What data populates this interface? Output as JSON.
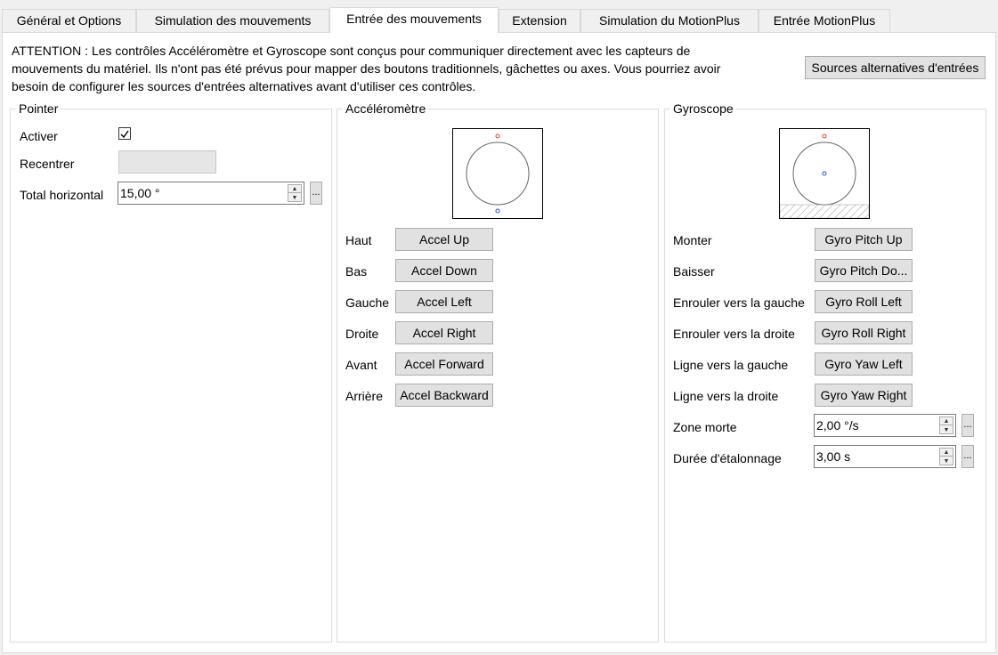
{
  "tabs": [
    {
      "label": "Général et Options"
    },
    {
      "label": "Simulation des mouvements"
    },
    {
      "label": "Entrée des mouvements"
    },
    {
      "label": "Extension"
    },
    {
      "label": "Simulation du MotionPlus"
    },
    {
      "label": "Entrée MotionPlus"
    }
  ],
  "active_tab": "Entrée des mouvements",
  "warning": {
    "line1": "ATTENTION : Les contrôles Accéléromètre et Gyroscope sont conçus pour communiquer directement avec les capteurs de",
    "line2": "mouvements du matériel. Ils n'ont pas été prévus pour mapper des boutons traditionnels, gâchettes ou axes. Vous pourriez avoir",
    "line3": "besoin de configurer les sources d'entrées alternatives avant d'utiliser ces contrôles."
  },
  "alt_sources_button": "Sources alternatives d'entrées",
  "pointer": {
    "title": "Pointer",
    "enable_label": "Activer",
    "enable_checked": true,
    "recenter_label": "Recentrer",
    "total_horizontal_label": "Total horizontal",
    "total_horizontal_value": "15,00 °",
    "more": "..."
  },
  "accelerometer": {
    "title": "Accéléromètre",
    "rows": [
      {
        "label": "Haut",
        "button": "Accel Up"
      },
      {
        "label": "Bas",
        "button": "Accel Down"
      },
      {
        "label": "Gauche",
        "button": "Accel Left"
      },
      {
        "label": "Droite",
        "button": "Accel Right"
      },
      {
        "label": "Avant",
        "button": "Accel Forward"
      },
      {
        "label": "Arrière",
        "button": "Accel Backward"
      }
    ]
  },
  "gyroscope": {
    "title": "Gyroscope",
    "rows": [
      {
        "label": "Monter",
        "button": "Gyro Pitch Up"
      },
      {
        "label": "Baisser",
        "button": "Gyro Pitch Do..."
      },
      {
        "label": "Enrouler vers la gauche",
        "button": "Gyro Roll Left"
      },
      {
        "label": "Enrouler vers la droite",
        "button": "Gyro Roll Right"
      },
      {
        "label": "Ligne vers la gauche",
        "button": "Gyro Yaw Left"
      },
      {
        "label": "Ligne vers la droite",
        "button": "Gyro Yaw Right"
      }
    ],
    "deadzone_label": "Zone morte",
    "deadzone_value": "2,00 °/s",
    "calibration_label": "Durée d'étalonnage",
    "calibration_value": "3,00 s",
    "more": "..."
  },
  "colors": {
    "accent_red": "#e04040",
    "accent_blue": "#3050c0"
  }
}
